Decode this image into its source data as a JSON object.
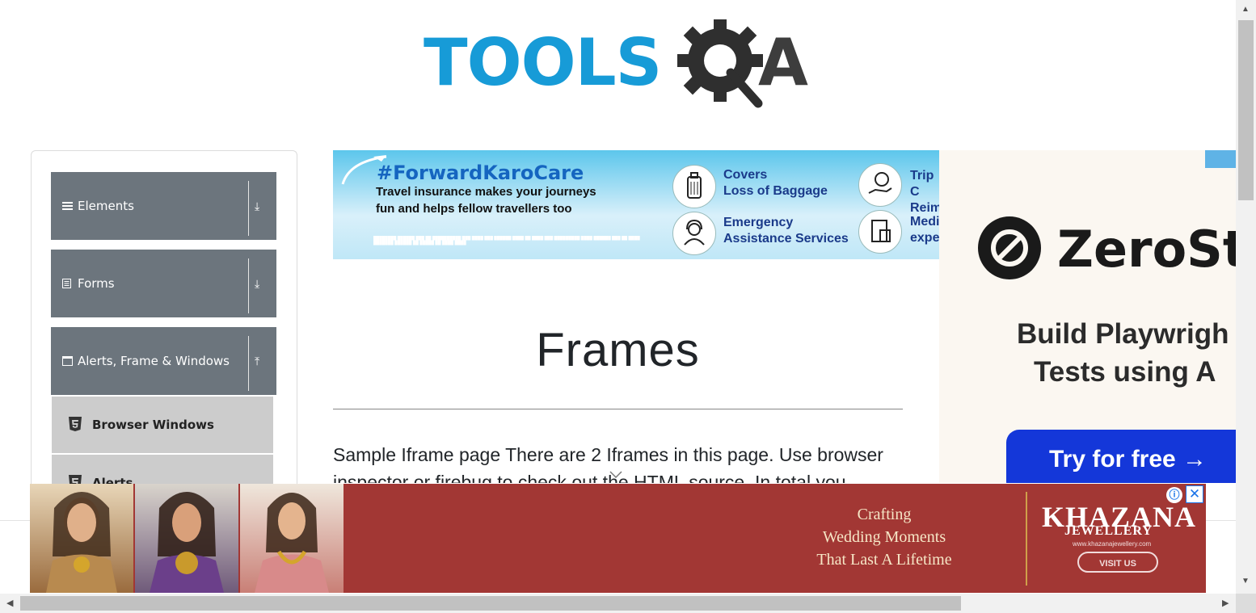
{
  "header": {
    "logo_text_left": "TOOLS",
    "logo_text_right": "A"
  },
  "sidebar": {
    "groups": [
      {
        "label": "Elements",
        "icon": "hamburger-icon",
        "arrow": "⤓"
      },
      {
        "label": "Forms",
        "icon": "document-icon",
        "arrow": "⤓"
      },
      {
        "label": "Alerts, Frame & Windows",
        "icon": "window-icon",
        "arrow": "⤒"
      }
    ],
    "items": [
      {
        "label": "Browser Windows",
        "icon": "html5-icon"
      },
      {
        "label": "Alerts",
        "icon": "html5-icon"
      }
    ]
  },
  "ad_top": {
    "hashtag": "#ForwardKaroCare",
    "line1": "Travel insurance makes your journeys",
    "line2": "fun and helps fellow travellers too",
    "feature1_line1": "Covers",
    "feature1_line2": "Loss of Baggage",
    "feature2_line1": "Emergency",
    "feature2_line2": "Assistance Services",
    "feature3_line1": "Trip C",
    "feature3_line2": "Reim",
    "feature4_line1": "Medi",
    "feature4_line2": "expe"
  },
  "ad_right": {
    "brand": "ZeroSte",
    "headline1": "Build Playwrigh",
    "headline2": "Tests using A",
    "cta": "Try for free →"
  },
  "main": {
    "title": "Frames",
    "text_line1": "Sample Iframe page There are 2 Iframes in this page. Use browser",
    "text_line2": "inspector or firebug to check out the HTML source. In total you"
  },
  "ad_bottom": {
    "tagline1": "Crafting",
    "tagline2": "Wedding Moments",
    "tagline3": "That Last A Lifetime",
    "brand_line1": "KHAZANA",
    "brand_line2": "JEWELLERY",
    "website": "www.khazanajewellery.com",
    "visit": "VISIT US",
    "info_glyph": "ⓘ",
    "close_glyph": "✕"
  },
  "colors": {
    "sidebar_header_bg": "#6c757d",
    "sidebar_item_bg": "#cccccc",
    "logo_blue": "#179bd7",
    "logo_dark": "#3d3d3d",
    "cta_blue": "#1437d9",
    "bottom_ad_red": "#a23734"
  }
}
